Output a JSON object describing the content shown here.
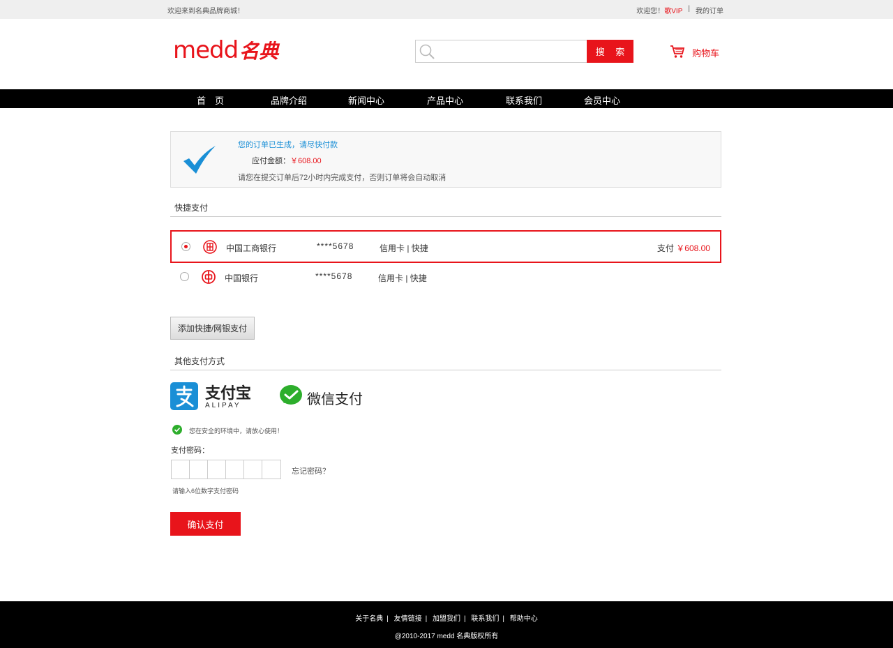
{
  "topbar": {
    "welcome": "欢迎来到名典品牌商城！",
    "greeting": "欢迎您！",
    "user": "歌VIP",
    "separator": "|",
    "orders": "我的订单"
  },
  "logo": {
    "en": "medd",
    "cn": "名典"
  },
  "search": {
    "placeholder": "",
    "button": "搜 索"
  },
  "cart": {
    "label": "购物车"
  },
  "nav": [
    "首　页",
    "品牌介绍",
    "新闻中心",
    "产品中心",
    "联系我们",
    "会员中心"
  ],
  "order": {
    "created": "您的订单已生成，请尽快付款",
    "amount_label": "应付金额：",
    "amount": "￥608.00",
    "notice": "请您在提交订单后72小时内完成支付，否则订单将会自动取消"
  },
  "quick_pay": {
    "title": "快捷支付",
    "methods": [
      {
        "bank": "中国工商银行",
        "card": "****5678",
        "type": "信用卡 | 快捷",
        "pay_label": "支付",
        "pay_amount": "￥608.00",
        "selected": true
      },
      {
        "bank": "中国银行",
        "card": "****5678",
        "type": "信用卡 | 快捷",
        "selected": false
      }
    ],
    "add_button": "添加快捷/网银支付"
  },
  "other_pay": {
    "title": "其他支付方式",
    "alipay_zh": "支付宝",
    "alipay_en": "ALIPAY",
    "wechat": "微信支付"
  },
  "password": {
    "secure": "您在安全的环境中，请放心使用！",
    "label": "支付密码：",
    "forgot": "忘记密码？",
    "hint": "请输入6位数字支付密码"
  },
  "confirm_button": "确认支付",
  "footer": {
    "links": [
      "关于名典",
      "友情链接",
      "加盟我们",
      "联系我们",
      "帮助中心"
    ],
    "copyright": "@2010-2017 medd  名典版权所有"
  },
  "colors": {
    "accent": "#e8141b",
    "link_blue": "#1a8fd6",
    "alipay_blue": "#1a8fd6",
    "wechat_green": "#2dae2c"
  }
}
